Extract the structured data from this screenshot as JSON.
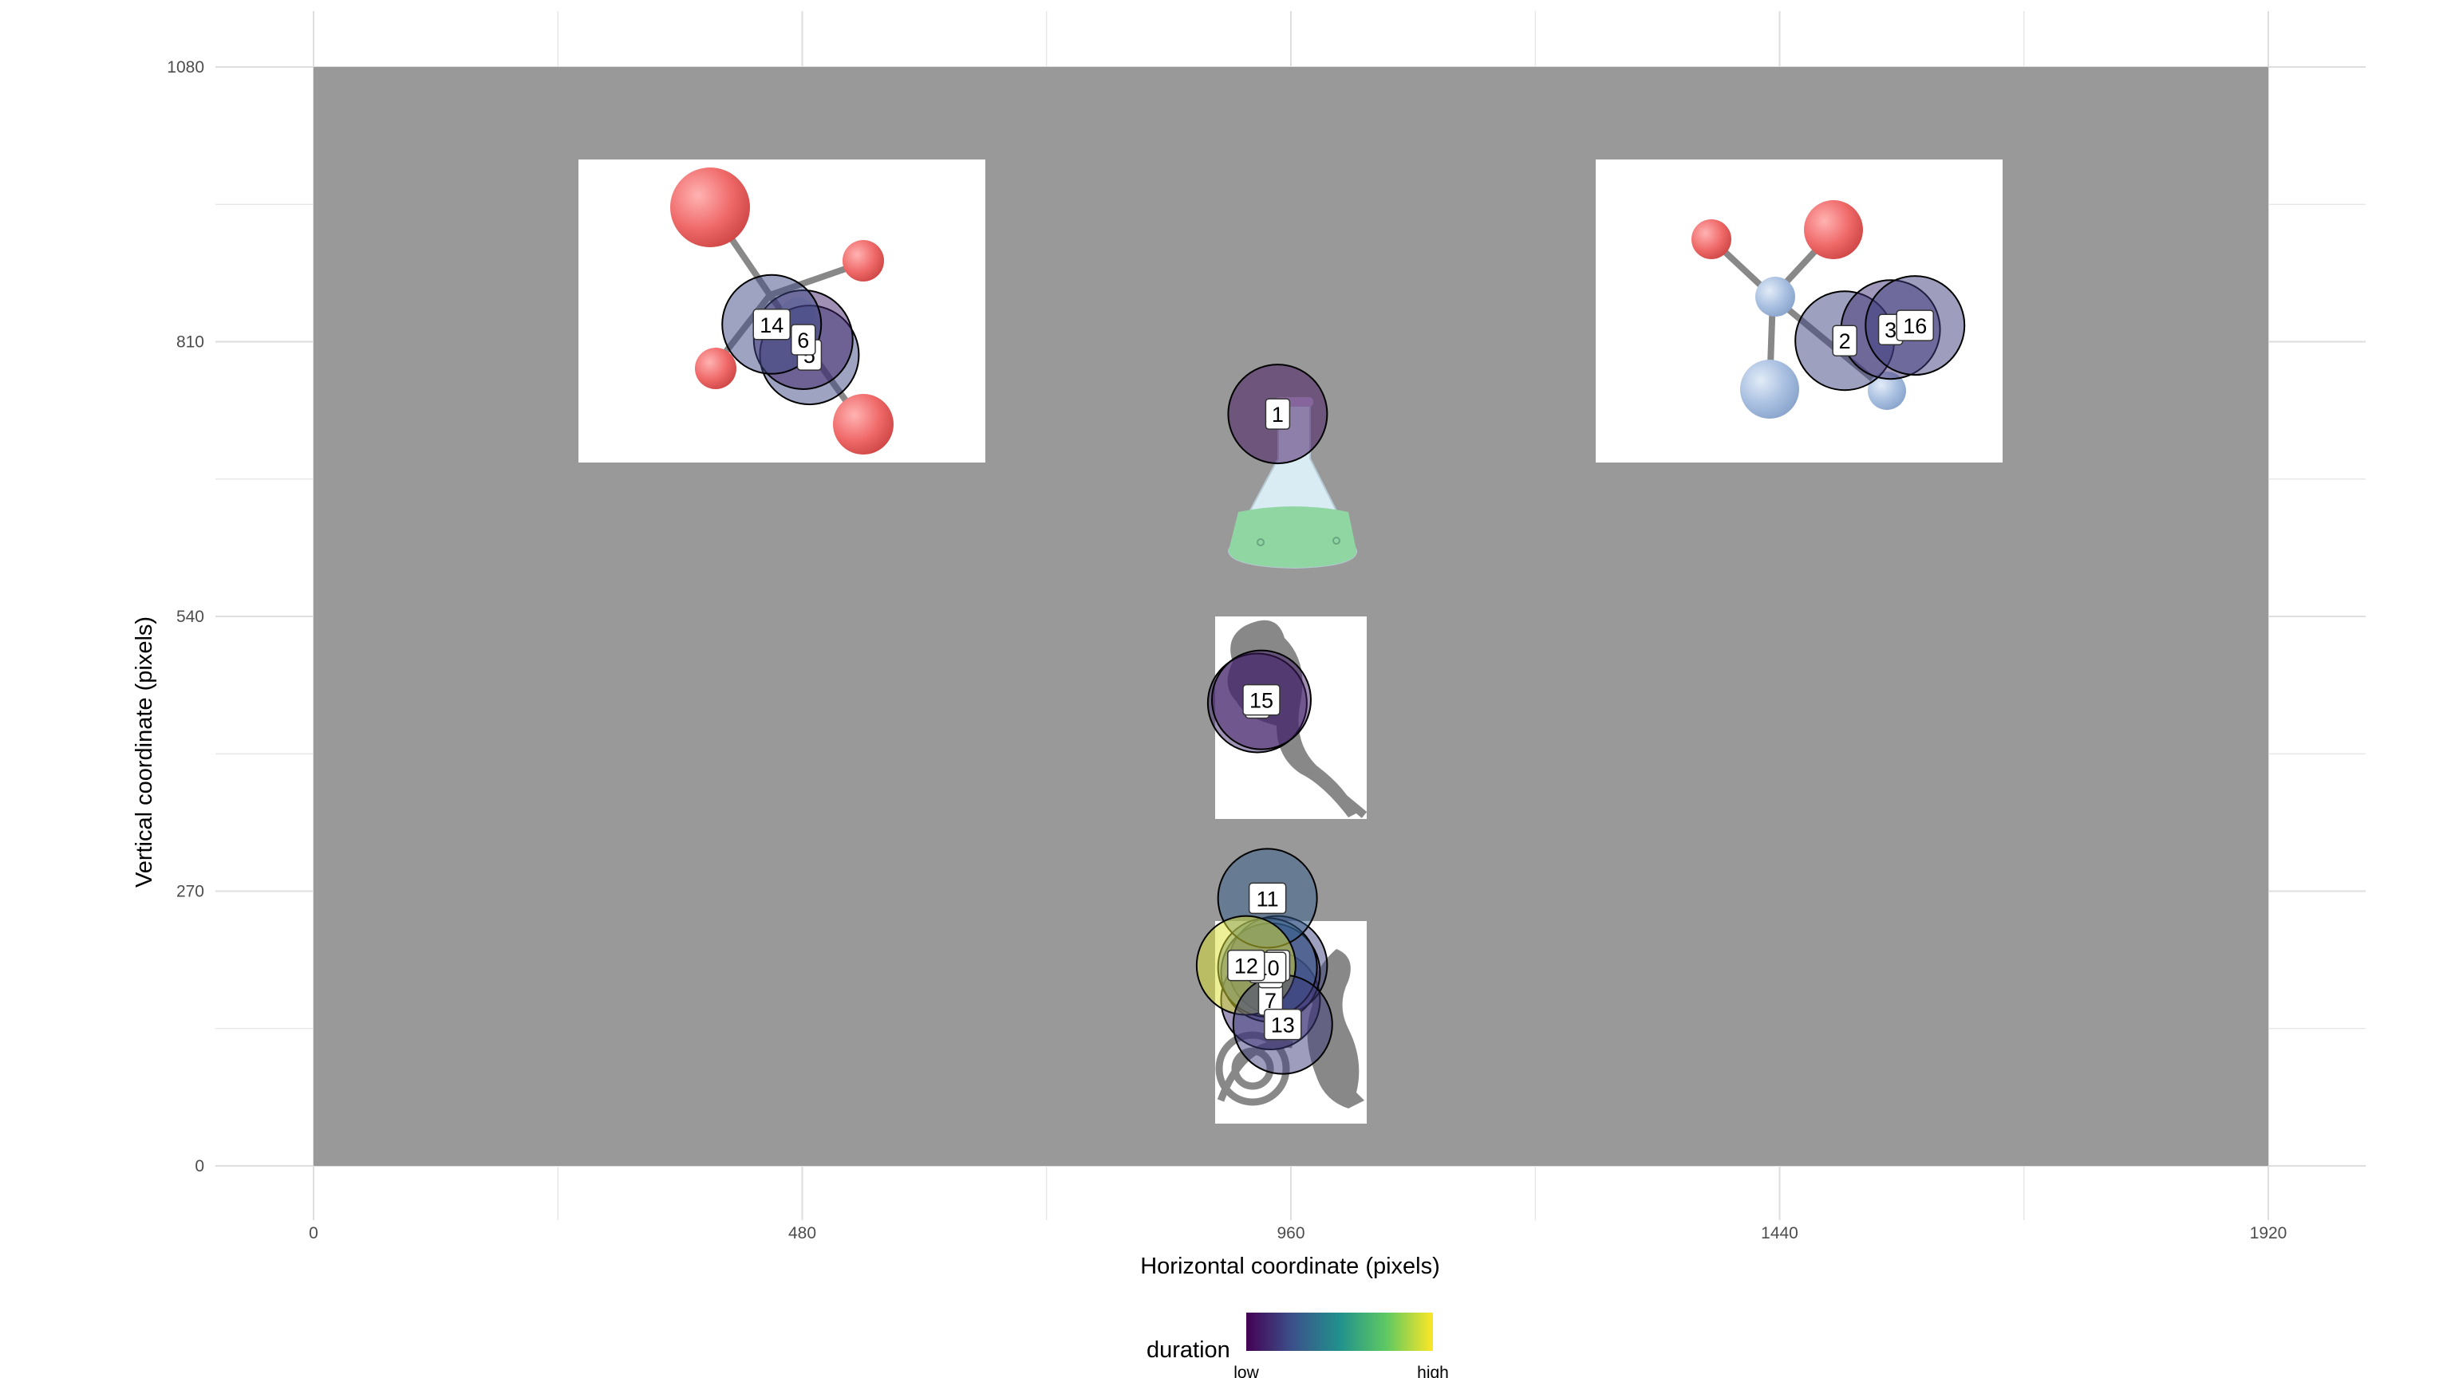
{
  "chart_data": {
    "type": "scatter",
    "title": "",
    "xlabel": "Horizontal coordinate (pixels)",
    "ylabel": "Vertical coordinate (pixels)",
    "xlim": [
      0,
      1920
    ],
    "ylim": [
      0,
      1080
    ],
    "xticks": [
      0,
      480,
      960,
      1440,
      1920
    ],
    "yticks": [
      0,
      270,
      540,
      810,
      1080
    ],
    "grid": true,
    "background_panel": [
      0,
      1920,
      0,
      1080
    ],
    "color_scale": {
      "name": "duration",
      "low_label": "low",
      "high_label": "high",
      "colors": [
        "#440154",
        "#3b528b",
        "#21918c",
        "#5ec962",
        "#fde725"
      ]
    },
    "legend_position": "bottom",
    "stimuli": [
      {
        "name": "molecule-left",
        "x": [
          260,
          660
        ],
        "y": [
          690,
          990
        ]
      },
      {
        "name": "molecule-right",
        "x": [
          1260,
          1660
        ],
        "y": [
          690,
          990
        ]
      },
      {
        "name": "flask",
        "x": [
          890,
          1030
        ],
        "y": [
          590,
          740
        ]
      },
      {
        "name": "kangaroo-top",
        "x": [
          885,
          1035
        ],
        "y": [
          340,
          540
        ]
      },
      {
        "name": "kangaroo-bottom",
        "x": [
          885,
          1035
        ],
        "y": [
          40,
          240
        ]
      }
    ],
    "points": [
      {
        "label": "1",
        "x": 947,
        "y": 739,
        "duration": 0.05
      },
      {
        "label": "2",
        "x": 1504,
        "y": 811,
        "duration": 0.2
      },
      {
        "label": "3",
        "x": 1549,
        "y": 822,
        "duration": 0.15
      },
      {
        "label": "4",
        "x": 927,
        "y": 455,
        "duration": 0.12
      },
      {
        "label": "5",
        "x": 487,
        "y": 797,
        "duration": 0.22
      },
      {
        "label": "6",
        "x": 481,
        "y": 812,
        "duration": 0.1
      },
      {
        "label": "7",
        "x": 940,
        "y": 163,
        "duration": 0.14
      },
      {
        "label": "8",
        "x": 947,
        "y": 197,
        "duration": 0.2
      },
      {
        "label": "9",
        "x": 940,
        "y": 190,
        "duration": 0.16
      },
      {
        "label": "10",
        "x": 937,
        "y": 195,
        "duration": 0.3
      },
      {
        "label": "11",
        "x": 937,
        "y": 263,
        "duration": 0.3
      },
      {
        "label": "12",
        "x": 916,
        "y": 197,
        "duration": 0.95
      },
      {
        "label": "13",
        "x": 952,
        "y": 139,
        "duration": 0.18
      },
      {
        "label": "14",
        "x": 450,
        "y": 827,
        "duration": 0.22
      },
      {
        "label": "15",
        "x": 931,
        "y": 458,
        "duration": 0.08
      },
      {
        "label": "16",
        "x": 1573,
        "y": 826,
        "duration": 0.18
      }
    ]
  }
}
